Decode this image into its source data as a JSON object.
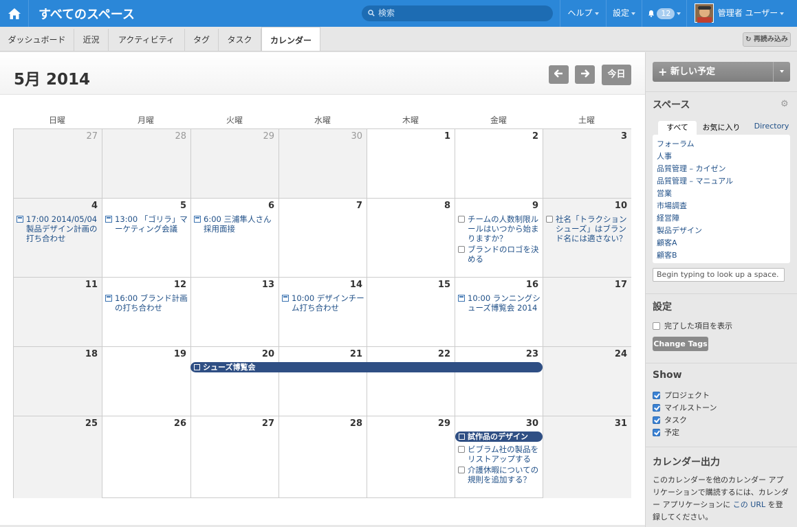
{
  "topbar": {
    "title": "すべてのスペース",
    "search_placeholder": "検索",
    "help": "ヘルプ",
    "settings": "設定",
    "notifications": "12",
    "user": "管理者 ユーザー"
  },
  "tabs": [
    "ダッシュボード",
    "近況",
    "アクティビティ",
    "タグ",
    "タスク",
    "カレンダー"
  ],
  "active_tab": "カレンダー",
  "reload": "再読み込み",
  "calendar": {
    "title": "5月 2014",
    "today": "今日",
    "weekdays": [
      "日曜",
      "月曜",
      "火曜",
      "水曜",
      "木曜",
      "金曜",
      "土曜"
    ],
    "days": [
      [
        "27",
        "28",
        "29",
        "30",
        "1",
        "2",
        "3"
      ],
      [
        "4",
        "5",
        "6",
        "7",
        "8",
        "9",
        "10"
      ],
      [
        "11",
        "12",
        "13",
        "14",
        "15",
        "16",
        "17"
      ],
      [
        "18",
        "19",
        "20",
        "21",
        "22",
        "23",
        "24"
      ],
      [
        "25",
        "26",
        "27",
        "28",
        "29",
        "30",
        "31"
      ]
    ],
    "events": {
      "e1": "17:00 2014/05/04 製品デザイン計画の打ち合わせ",
      "e2": "13:00 「ゴリラ」マーケティング会議",
      "e3": "6:00 三浦隼人さん採用面接",
      "t1": "チームの人数制限ルールはいつから始まりますか？",
      "t2": "ブランドのロゴを決める",
      "t3": "社名「トラクションシューズ」はブランド名には適さない？",
      "e4": "16:00 ブランド計画の打ち合わせ",
      "e5": "10:00 デザインチーム打ち合わせ",
      "e6": "10:00 ランニングシューズ博覧会 2014",
      "bar1": "シューズ博覧会",
      "bar2": "試作品のデザイン",
      "t4": "ビブラム社の製品をリストアップする",
      "t5": "介護休暇についての規則を追加する？"
    }
  },
  "sidebar": {
    "new_event": "新しい予定",
    "spaces_title": "スペース",
    "space_tabs": [
      "すべて",
      "お気に入り",
      "Directory"
    ],
    "spaces": [
      "フォーラム",
      "人事",
      "品質管理 – カイゼン",
      "品質管理 – マニュアル",
      "営業",
      "市場調査",
      "経営陣",
      "製品デザイン",
      "顧客A",
      "顧客B"
    ],
    "space_search_placeholder": "Begin typing to look up a space.",
    "settings_title": "設定",
    "show_completed": "完了した項目を表示",
    "change_tags": "Change Tags",
    "show_title": "Show",
    "show_items": [
      "プロジェクト",
      "マイルストーン",
      "タスク",
      "予定"
    ],
    "export_title": "カレンダー出力",
    "export_text_1": "このカレンダーを他のカレンダー アプリケーションで購読するには、カレンダー アプリケーションに ",
    "export_link": "この URL",
    "export_text_2": " を登録してください。"
  },
  "colors": {
    "topbar": "#2b87d8",
    "event_bar": "#2f4f84",
    "link": "#1f4f87"
  }
}
